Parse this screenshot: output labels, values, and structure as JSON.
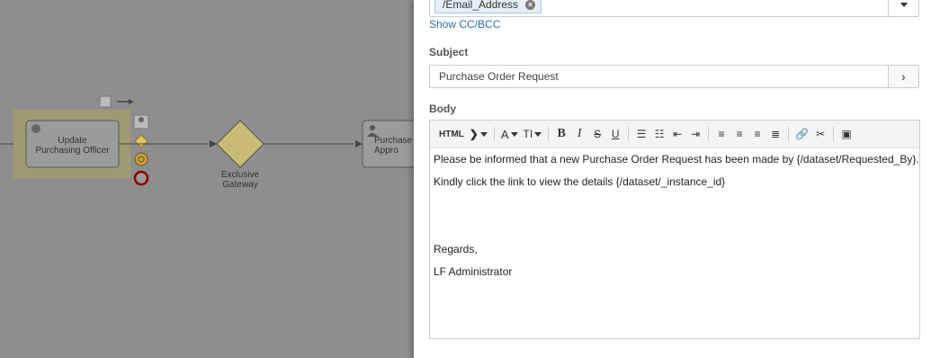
{
  "canvas": {
    "task1_label": "Update\nPurchasing Officer",
    "gateway_label": "Exclusive\nGateway",
    "task2_label": "Purchase\nAppro"
  },
  "email": {
    "to_token": "/Email_Address",
    "show_cc_bcc": "Show CC/BCC",
    "subject_label": "Subject",
    "subject_value": "Purchase Order Request",
    "body_label": "Body",
    "toolbar": {
      "html": "HTML",
      "bold": "B",
      "italic": "I",
      "strike": "S",
      "underline": "U"
    },
    "body_lines": [
      "Please be informed that a new Purchase Order Request has been made by {/dataset/Requested_By}.",
      "Kindly click the link to view the details {/dataset/_instance_id}",
      "",
      "",
      "Regards,",
      "LF Administrator"
    ]
  }
}
